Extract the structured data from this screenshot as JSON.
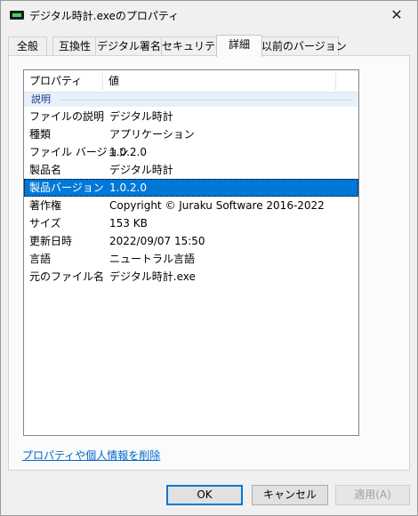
{
  "window": {
    "title": "デジタル時計.exeのプロパティ",
    "close_glyph": "✕"
  },
  "tabs": [
    {
      "label": "全般"
    },
    {
      "label": "互換性"
    },
    {
      "label": "デジタル署名"
    },
    {
      "label": "セキュリティ"
    },
    {
      "label": "詳細",
      "active": true
    },
    {
      "label": "以前のバージョン"
    }
  ],
  "details": {
    "columns": {
      "property": "プロパティ",
      "value": "値"
    },
    "group": "説明",
    "rows": [
      {
        "key": "ファイルの説明",
        "value": "デジタル時計"
      },
      {
        "key": "種類",
        "value": "アプリケーション"
      },
      {
        "key": "ファイル バージョン",
        "value": "1.0.2.0"
      },
      {
        "key": "製品名",
        "value": "デジタル時計"
      },
      {
        "key": "製品バージョン",
        "value": "1.0.2.0",
        "selected": true
      },
      {
        "key": "著作権",
        "value": "Copyright © Juraku Software 2016-2022"
      },
      {
        "key": "サイズ",
        "value": "153 KB"
      },
      {
        "key": "更新日時",
        "value": "2022/09/07 15:50"
      },
      {
        "key": "言語",
        "value": "ニュートラル言語"
      },
      {
        "key": "元のファイル名",
        "value": "デジタル時計.exe"
      }
    ]
  },
  "remove_link": "プロパティや個人情報を削除",
  "buttons": {
    "ok": "OK",
    "cancel": "キャンセル",
    "apply": "適用(A)"
  },
  "colors": {
    "selection": "#0078d7",
    "link": "#0066cc",
    "group_text": "#1e3287"
  }
}
